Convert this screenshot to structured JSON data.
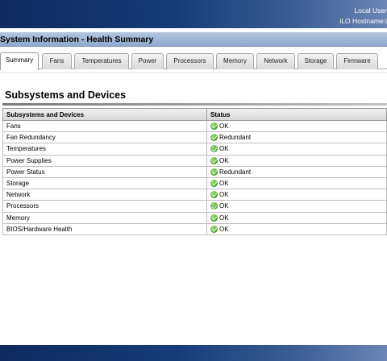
{
  "header": {
    "user_label": "Local User",
    "hostname_label": "iLO Hostname:i"
  },
  "page": {
    "title": "System Information - Health Summary"
  },
  "tabs": [
    {
      "label": "Summary",
      "active": true
    },
    {
      "label": "Fans",
      "active": false
    },
    {
      "label": "Temperatures",
      "active": false
    },
    {
      "label": "Power",
      "active": false
    },
    {
      "label": "Processors",
      "active": false
    },
    {
      "label": "Memory",
      "active": false
    },
    {
      "label": "Network",
      "active": false
    },
    {
      "label": "Storage",
      "active": false
    },
    {
      "label": "Firmware",
      "active": false
    }
  ],
  "section": {
    "title": "Subsystems and Devices"
  },
  "table": {
    "headers": [
      "Subsystems and Devices",
      "Status"
    ],
    "rows": [
      {
        "name": "Fans",
        "status": "OK",
        "icon": "ok-check-icon"
      },
      {
        "name": "Fan Redundancy",
        "status": "Redundant",
        "icon": "ok-check-icon"
      },
      {
        "name": "Temperatures",
        "status": "OK",
        "icon": "ok-check-icon"
      },
      {
        "name": "Power Supplies",
        "status": "OK",
        "icon": "ok-check-icon"
      },
      {
        "name": "Power Status",
        "status": "Redundant",
        "icon": "ok-check-icon"
      },
      {
        "name": "Storage",
        "status": "OK",
        "icon": "ok-check-icon"
      },
      {
        "name": "Network",
        "status": "OK",
        "icon": "ok-check-icon"
      },
      {
        "name": "Processors",
        "status": "OK",
        "icon": "ok-check-icon"
      },
      {
        "name": "Memory",
        "status": "OK",
        "icon": "ok-check-icon"
      },
      {
        "name": "BIOS/Hardware Health",
        "status": "OK",
        "icon": "ok-check-icon"
      }
    ]
  },
  "colors": {
    "header_dark": "#0e2a5e",
    "header_light": "#6b86b4",
    "status_ok": "#4aa52c"
  }
}
